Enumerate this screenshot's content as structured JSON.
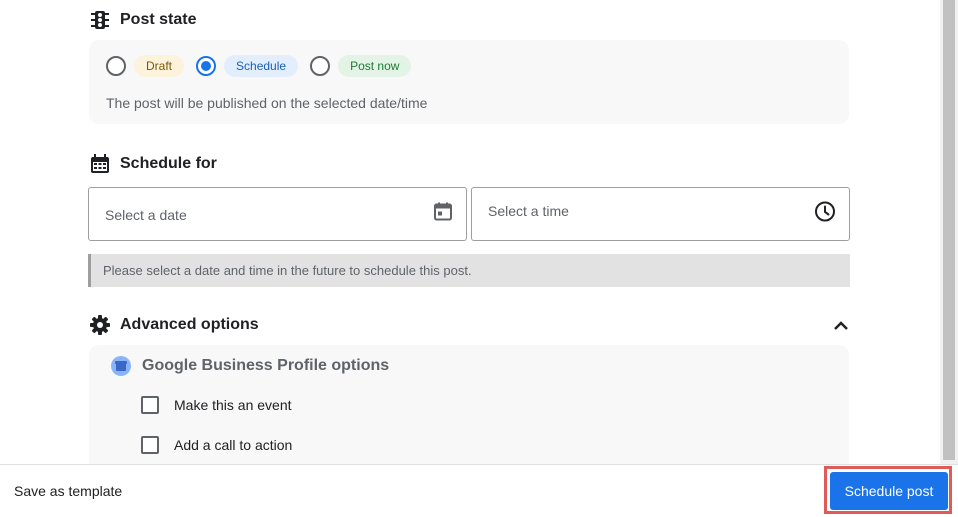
{
  "post_state": {
    "heading": "Post state",
    "options": [
      {
        "label": "Draft",
        "selected": false
      },
      {
        "label": "Schedule",
        "selected": true
      },
      {
        "label": "Post now",
        "selected": false
      }
    ],
    "help_text": "The post will be published on the selected date/time"
  },
  "schedule": {
    "heading": "Schedule for",
    "date_placeholder": "Select a date",
    "time_placeholder": "Select a time",
    "notice": "Please select a date and time in the future to schedule this post."
  },
  "advanced": {
    "heading": "Advanced options",
    "gbp_heading": "Google Business Profile options",
    "checkboxes": [
      {
        "label": "Make this an event",
        "checked": false
      },
      {
        "label": "Add a call to action",
        "checked": false
      }
    ]
  },
  "footer": {
    "save_template": "Save as template",
    "primary_button": "Schedule post"
  },
  "colors": {
    "accent": "#1a73e8",
    "highlight": "#e05a5a"
  }
}
